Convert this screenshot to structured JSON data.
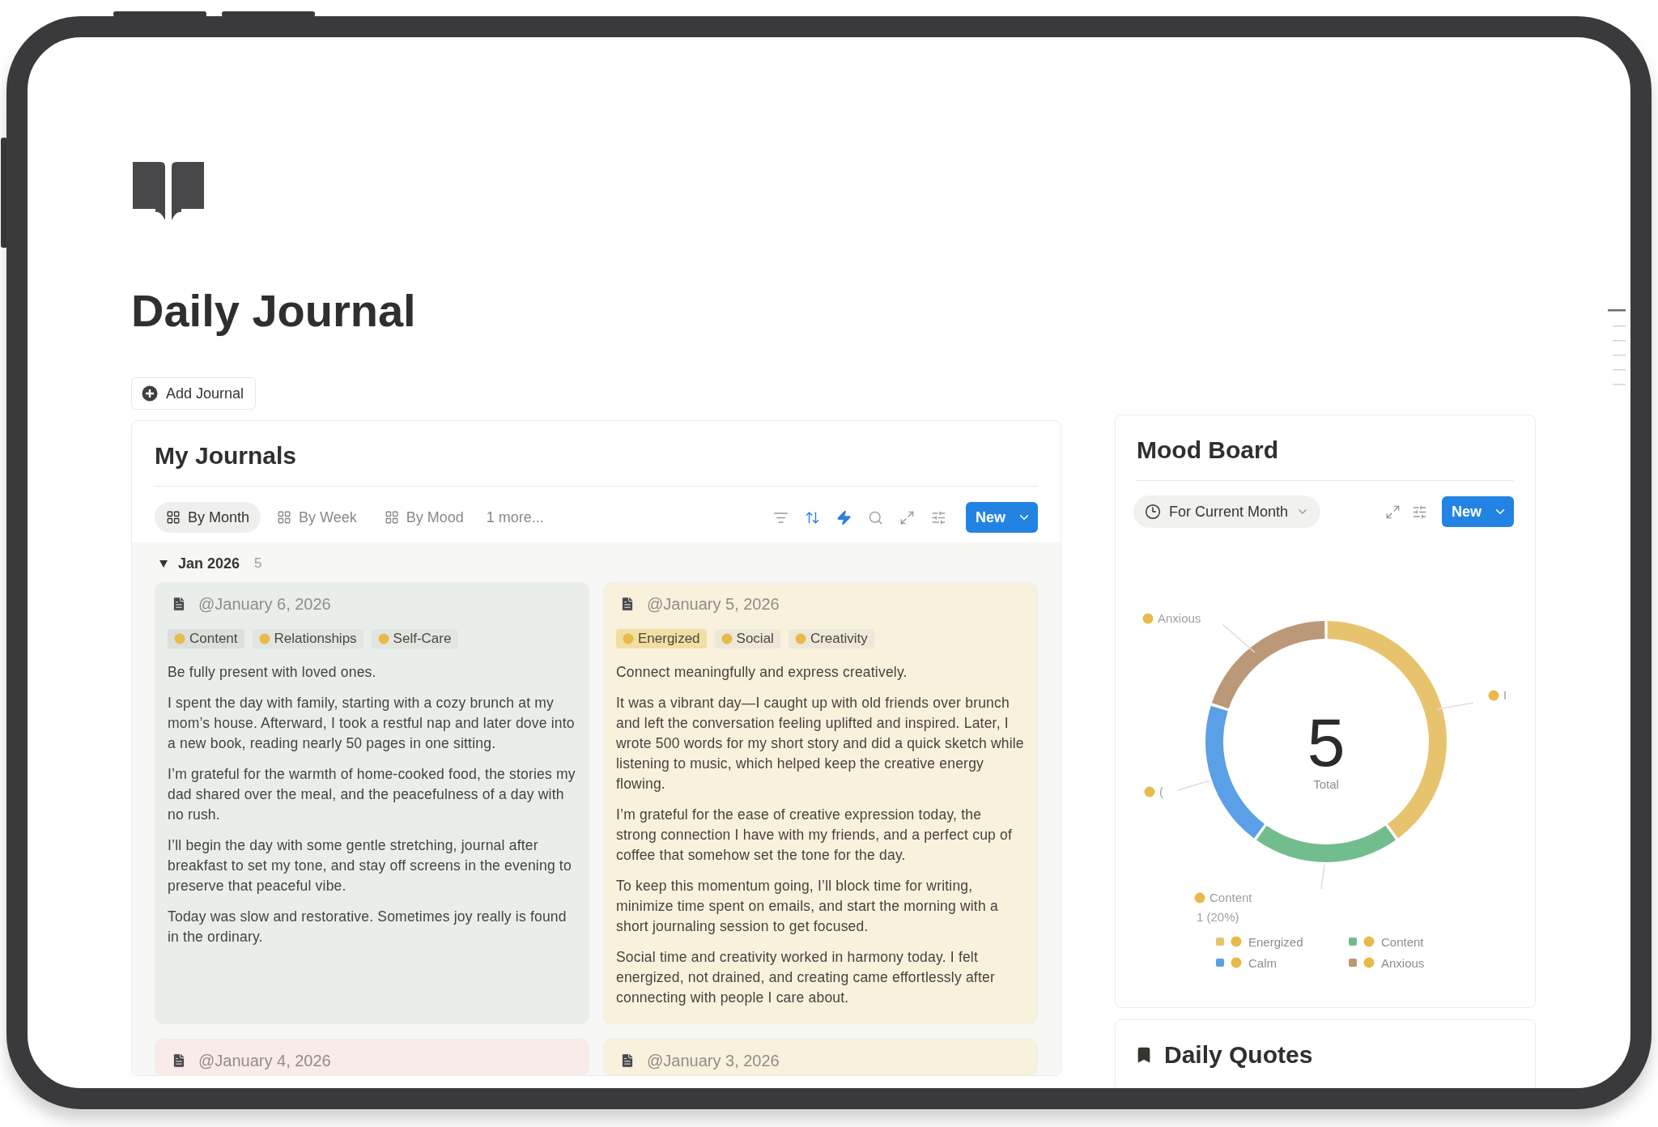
{
  "page": {
    "title": "Daily Journal",
    "add_button": "Add Journal"
  },
  "journals": {
    "title": "My Journals",
    "tabs": [
      {
        "label": "By Month",
        "selected": true
      },
      {
        "label": "By Week",
        "selected": false
      },
      {
        "label": "By Mood",
        "selected": false
      }
    ],
    "more_tabs": "1 more...",
    "toolbar": [
      {
        "kind": "filter",
        "active": false
      },
      {
        "kind": "sort",
        "active": true
      },
      {
        "kind": "automation",
        "active": true
      },
      {
        "kind": "search",
        "active": false
      },
      {
        "kind": "expand",
        "active": false
      },
      {
        "kind": "settings",
        "active": false
      }
    ],
    "new_button": "New",
    "group": {
      "label": "Jan 2026",
      "count": "5",
      "expanded": true
    },
    "cards": [
      {
        "date": "@January 6, 2026",
        "color": "#e9eeea",
        "tags": [
          {
            "label": "Content",
            "color": "#dcdfdb"
          },
          {
            "label": "Relationships",
            "color": "#e2e5e1"
          },
          {
            "label": "Self-Care",
            "color": "#e2e5e1"
          }
        ],
        "paragraphs": [
          "Be fully present with loved ones.",
          "I spent the day with family, starting with a cozy brunch at my mom’s house. Afterward, I took a restful nap and later dove into a new book, reading nearly 50 pages in one sitting.",
          "I’m grateful for the warmth of home-cooked food, the stories my dad shared over the meal, and the peacefulness of a day with no rush.",
          "I’ll begin the day with some gentle stretching, journal after breakfast to set my tone, and stay off screens in the evening to preserve that peaceful vibe.",
          "Today was slow and restorative. Sometimes joy really is found in the ordinary."
        ]
      },
      {
        "date": "@January 5, 2026",
        "color": "#f8f1dc",
        "tags": [
          {
            "label": "Energized",
            "color": "#f3dea3"
          },
          {
            "label": "Social",
            "color": "#ede8d8"
          },
          {
            "label": "Creativity",
            "color": "#ede8d8"
          }
        ],
        "paragraphs": [
          "Connect meaningfully and express creatively.",
          "It was a vibrant day—I caught up with old friends over brunch and left the conversation feeling uplifted and inspired. Later, I wrote 500 words for my short story and did a quick sketch while listening to music, which helped keep the creative energy flowing.",
          "I’m grateful for the ease of creative expression today, the strong connection I have with my friends, and a perfect cup of coffee that somehow set the tone for the day.",
          "To keep this momentum going, I’ll block time for writing, minimize time spent on emails, and start the morning with a short journaling session to get focused.",
          "Social time and creativity worked in harmony today. I felt energized, not drained, and creating came effortlessly after connecting with people I care about."
        ]
      },
      {
        "date": "@January 4, 2026",
        "color": "#f8ebe8"
      },
      {
        "date": "@January 3, 2026",
        "color": "#f8f1dc"
      }
    ]
  },
  "mood_board": {
    "title": "Mood Board",
    "filter": "For Current Month",
    "toolbar": [
      {
        "kind": "expand",
        "active": false
      },
      {
        "kind": "settings",
        "active": false
      }
    ],
    "new_button": "New",
    "chart_data": {
      "type": "donut",
      "categories": [
        "Energized",
        "Content",
        "Calm",
        "Anxious"
      ],
      "values": [
        40,
        20,
        20,
        20
      ]
    },
    "center_value": "5",
    "center_label": "Total",
    "slice_labels": [
      {
        "text": "Anxious"
      },
      {
        "text": "I"
      },
      {
        "text": "("
      }
    ],
    "tooltip": {
      "title": "Content",
      "value": "1 (20%)"
    },
    "legend": [
      {
        "color": "#e8c36e"
      },
      {
        "color": "#72bd8d"
      },
      {
        "color": "#5b9fe6"
      },
      {
        "color": "#bb9878"
      }
    ]
  },
  "quotes": {
    "title": "Daily Quotes"
  }
}
